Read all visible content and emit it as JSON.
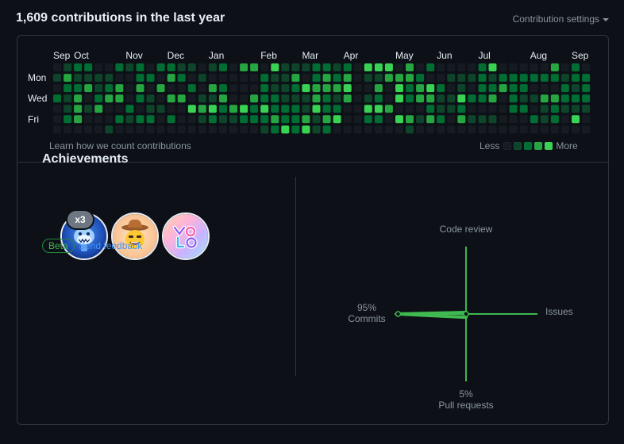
{
  "header": {
    "title": "1,609 contributions in the last year",
    "settings_label": "Contribution settings"
  },
  "graph": {
    "months": [
      "Sep",
      "Oct",
      "Nov",
      "Dec",
      "Jan",
      "Feb",
      "Mar",
      "Apr",
      "May",
      "Jun",
      "Jul",
      "Aug",
      "Sep"
    ],
    "month_weeks": [
      0,
      2,
      7,
      11,
      15,
      20,
      24,
      28,
      33,
      37,
      41,
      46,
      50
    ],
    "days": [
      "Mon",
      "Wed",
      "Fri"
    ],
    "levels": [
      "0122002120221101203304111221204440302000024000003020",
      "1311110022032010000021130232301133320011121222222122",
      "0223123030300203200021124333400304234201022322000212",
      "2130233021033011300322111321301204233114223021133222",
      "0131300201100434234242221422004430002112000022012111",
      "0230002122020012112223223134002204313203111000212040",
      "0000010000000000000012424120000000100000000000000000"
    ],
    "colors": [
      "#161b22",
      "#0e4429",
      "#006d32",
      "#26a641",
      "#39d353"
    ],
    "learn_link": "Learn how we count contributions",
    "legend_less": "Less",
    "legend_more": "More"
  },
  "achievements": {
    "title": "Achievements",
    "badges": [
      {
        "name": "Pull Shark",
        "icon": "shark-icon",
        "count": "x3"
      },
      {
        "name": "Starstruck",
        "icon": "cowboy-icon"
      },
      {
        "name": "YOLO",
        "icon": "yolo-icon"
      }
    ],
    "beta_label": "Beta",
    "feedback_label": "Send feedback"
  },
  "activity": {
    "code_review": {
      "label": "Code review",
      "percent": ""
    },
    "issues": {
      "label": "Issues",
      "percent": ""
    },
    "commits": {
      "label": "Commits",
      "percent": "95%",
      "value": 95
    },
    "pull_requests": {
      "label": "Pull requests",
      "percent": "5%",
      "value": 5
    },
    "color": "#3fb950"
  }
}
